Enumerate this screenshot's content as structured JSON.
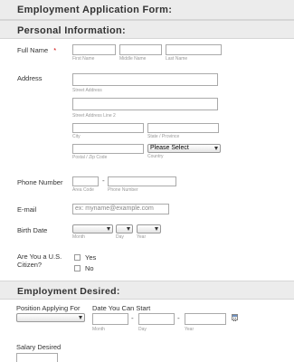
{
  "form_title": "Employment Application Form:",
  "personal": {
    "heading": "Personal Information:",
    "full_name": {
      "label": "Full Name",
      "required": "*",
      "first": "First Name",
      "middle": "Middle Name",
      "last": "Last Name"
    },
    "address": {
      "label": "Address",
      "street": "Street Address",
      "street2": "Street Address Line 2",
      "city": "City",
      "state": "State / Province",
      "postal": "Postal / Zip Code",
      "country": "Country",
      "country_select": "Please Select"
    },
    "phone": {
      "label": "Phone Number",
      "dash": "-",
      "area": "Area Code",
      "number": "Phone Number"
    },
    "email": {
      "label": "E-mail",
      "placeholder": "ex: myname@example.com"
    },
    "birth": {
      "label": "Birth Date",
      "month": "Month",
      "day": "Day",
      "year": "Year"
    },
    "citizen": {
      "label_line1": "Are You a U.S.",
      "label_line2": "Citizen?",
      "options": [
        "Yes",
        "No"
      ]
    }
  },
  "employment": {
    "heading": "Employment Desired:",
    "position": {
      "label": "Position Applying For"
    },
    "start": {
      "label": "Date You Can Start",
      "dash": "-",
      "month": "Month",
      "day": "Day",
      "year": "Year"
    },
    "salary": {
      "label": "Salary Desired"
    }
  },
  "icons": {
    "calendar": "calendar-icon",
    "dropdown": "chevron-down-icon"
  }
}
